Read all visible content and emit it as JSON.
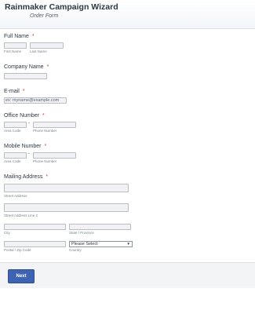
{
  "header": {
    "title": "Rainmaker Campaign Wizard",
    "subtitle": "Order Form"
  },
  "fields": {
    "full_name": {
      "label": "Full Name",
      "required": "*",
      "first_sub": "First Name",
      "last_sub": "Last Name"
    },
    "company": {
      "label": "Company Name",
      "required": "*"
    },
    "email": {
      "label": "E-mail",
      "required": "*",
      "placeholder": "ex: myname@example.com"
    },
    "office": {
      "label": "Office Number",
      "required": "*",
      "area_sub": "Area Code",
      "phone_sub": "Phone Number",
      "dash": "-"
    },
    "mobile": {
      "label": "Mobile Number",
      "required": "*",
      "area_sub": "Area Code",
      "phone_sub": "Phone Number",
      "dash": "-"
    },
    "address": {
      "label": "Mailing Address",
      "required": "*",
      "street_sub": "Street Address",
      "street2_sub": "Street Address Line 2",
      "city_sub": "City",
      "state_sub": "State / Province",
      "postal_sub": "Postal / Zip Code",
      "country_sub": "Country",
      "country_value": "Please Select"
    }
  },
  "footer": {
    "next_label": "Next"
  },
  "colors": {
    "accent": "#3e63b3",
    "required": "#d23a3a"
  }
}
